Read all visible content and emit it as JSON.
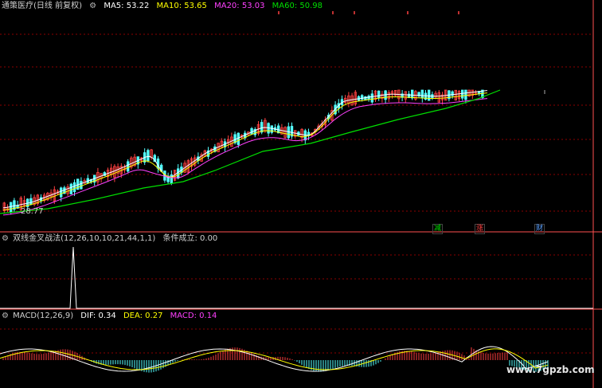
{
  "title_bar": {
    "stock_name": "通策医疗(日线 前复权)",
    "ma5": "MA5: 53.22",
    "ma10": "MA10: 53.65",
    "ma20": "MA20: 53.03",
    "ma60": "MA60: 50.98"
  },
  "low_price_label": "28.77",
  "flags": {
    "f1": "减",
    "f2": "涨",
    "f3": "财"
  },
  "indicator_panel": {
    "title": "双线金叉战法(12,26,10,10,21,44,1,1)",
    "status": "条件成立: 0.00"
  },
  "macd_panel": {
    "title": "MACD(12,26,9)",
    "dif": "DIF: 0.34",
    "dea": "DEA: 0.27",
    "macd": "MACD: 0.14"
  },
  "watermark": "www.7gpzb.com",
  "colors": {
    "up": "#ff4040",
    "down": "#54ffff",
    "ma5": "#ffffff",
    "ma10": "#ffff00",
    "ma20": "#ff40ff",
    "ma60": "#00e000",
    "grid": "#8b0000",
    "divider": "#ff5050"
  }
}
